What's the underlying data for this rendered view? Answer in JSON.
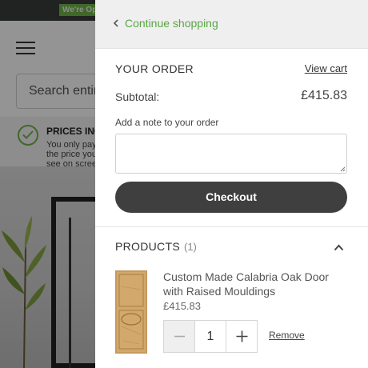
{
  "background_page": {
    "open_badge": "We're Open",
    "search_placeholder": "Search entire store here...",
    "prices_title": "PRICES INCLUDE VAT",
    "prices_subtitle": "You only pay the price you see on screen"
  },
  "drawer": {
    "continue_label": "Continue shopping",
    "order_title": "YOUR ORDER",
    "view_cart_label": "View cart",
    "subtotal_label": "Subtotal:",
    "subtotal_value": "£415.83",
    "note_label": "Add a note to your order",
    "note_value": "",
    "checkout_label": "Checkout",
    "products_title": "PRODUCTS",
    "products_count": "(1)"
  },
  "products": [
    {
      "name": "Custom Made Calabria Oak Door with Raised Mouldings",
      "price": "£415.83",
      "quantity": "1",
      "remove_label": "Remove"
    }
  ],
  "colors": {
    "accent_green": "#5aa545",
    "checkout_button": "#3f3f3f",
    "drawer_header": "#efefef"
  },
  "icons": [
    "chevron-left-icon",
    "chevron-up-icon",
    "minus-icon",
    "plus-icon",
    "menu-icon",
    "check-circle-icon"
  ]
}
